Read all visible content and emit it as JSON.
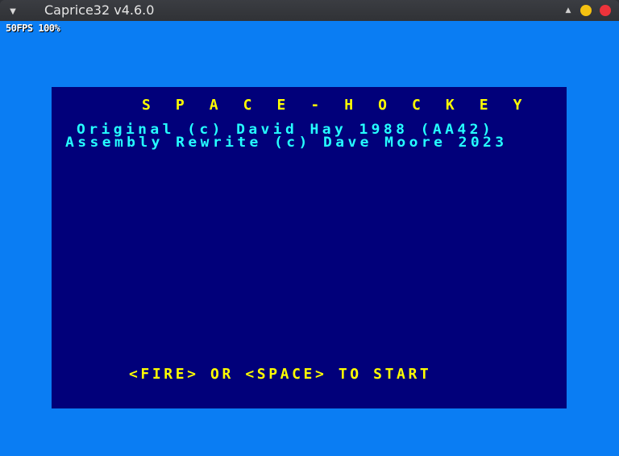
{
  "window": {
    "title": "Caprice32 v4.6.0",
    "menu_icon": "chevron-down-icon",
    "controls": [
      "up-arrow-icon",
      "minimize-icon",
      "close-icon"
    ],
    "colors": {
      "minimize": "#f5c211",
      "close": "#ed333b"
    }
  },
  "emulator": {
    "fps_readout": "50FPS 100%",
    "border_color": "#0a7df3",
    "paper_color": "#01007a"
  },
  "game": {
    "title": "S P A C E - H O C K E Y",
    "credit_original": "Original (c) David Hay 1988 (AA42)",
    "credit_rewrite": "Assembly Rewrite (c) Dave Moore 2023",
    "start_prompt": "<FIRE> OR <SPACE> TO START",
    "colors": {
      "title": "#ffff00",
      "credits": "#25ffff",
      "prompt": "#ffff00"
    }
  }
}
